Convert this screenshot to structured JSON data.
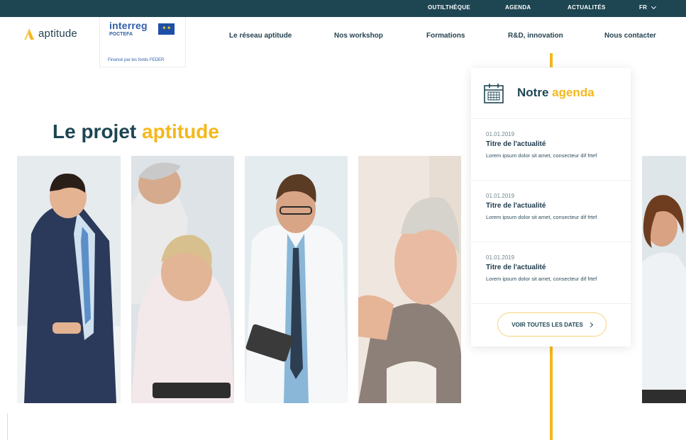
{
  "topbar": {
    "links": [
      "OUTILTHÈQUE",
      "AGENDA",
      "ACTUALITÉS"
    ],
    "language": "FR"
  },
  "header": {
    "logo_text": "aptitude",
    "interreg": {
      "name": "interreg",
      "program": "POCTEFA",
      "funding": "Financé par les fonds FEDER"
    },
    "nav": [
      "Le réseau aptitude",
      "Nos workshop",
      "Formations",
      "R&D, innovation",
      "Nous contacter"
    ]
  },
  "hero": {
    "title_prefix": "Le projet",
    "title_accent": "aptitude"
  },
  "agenda": {
    "title_prefix": "Notre",
    "title_accent": "agenda",
    "events": [
      {
        "date": "01.01.2019",
        "title": "Titre de l'actualité",
        "description": "Lorem ipsum dolor sit amet, consecteur dif frtef"
      },
      {
        "date": "01.01.2019",
        "title": "Titre de l'actualité",
        "description": "Lorem ipsum dolor sit amet, consecteur dif frtef"
      },
      {
        "date": "01.01.2019",
        "title": "Titre de l'actualité",
        "description": "Lorem ipsum dolor sit amet, consecteur dif frtef"
      }
    ],
    "button_label": "VOIR TOUTES LES DATES"
  },
  "colors": {
    "dark_teal": "#1d4552",
    "accent_yellow": "#f5b81c",
    "interreg_blue": "#2f5fa8",
    "white": "#ffffff"
  },
  "icons": [
    "aptitude-logo-icon",
    "eu-flag-icon",
    "chevron-down-icon",
    "calendar-icon",
    "chevron-right-icon"
  ]
}
